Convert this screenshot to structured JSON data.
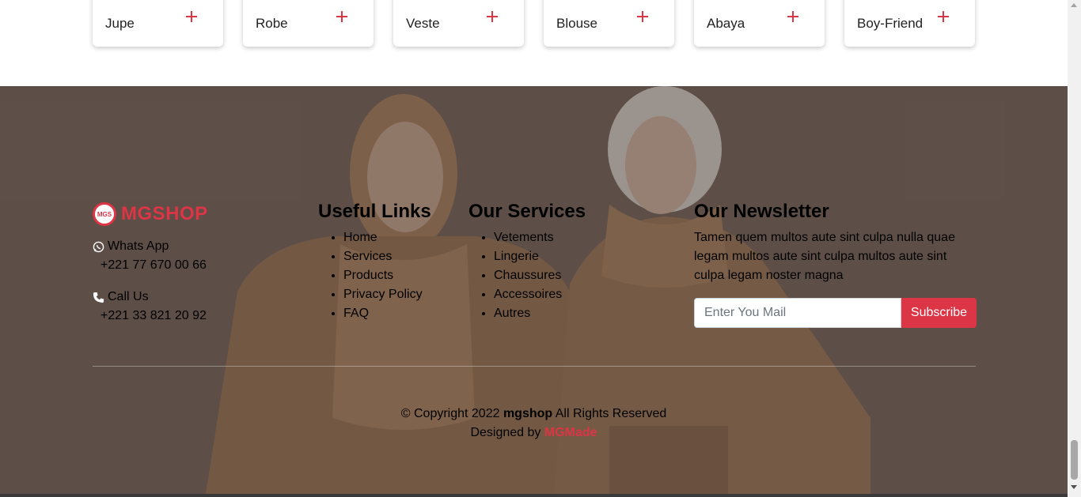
{
  "categories": [
    "Jupe",
    "Robe",
    "Veste",
    "Blouse",
    "Abaya",
    "Boy-Friend"
  ],
  "footer": {
    "logo_badge": "MGS",
    "brand": "MGSHOP",
    "whatsapp_label": "Whats App",
    "whatsapp_number": "+221 77 670 00 66",
    "call_label": "Call Us",
    "call_number": "+221 33 821 20 92",
    "useful_links_title": "Useful Links",
    "useful_links": [
      "Home",
      "Services",
      "Products",
      "Privacy Policy",
      "FAQ"
    ],
    "services_title": "Our Services",
    "services": [
      "Vetements",
      "Lingerie",
      "Chaussures",
      "Accessoires",
      "Autres"
    ],
    "newsletter_title": "Our Newsletter",
    "newsletter_text": "Tamen quem multos aute sint culpa nulla quae legam multos aute sint culpa multos aute sint culpa legam noster magna",
    "newsletter_placeholder": "Enter You Mail",
    "subscribe_label": "Subscribe",
    "copyright_prefix": "© Copyright 2022",
    "copyright_brand": "mgshop",
    "copyright_suffix": "All Rights Reserved",
    "designed_by": "Designed by",
    "designer": "MGMade"
  },
  "colors": {
    "accent": "#dc3545",
    "footer_bg": "#6b5a52"
  }
}
